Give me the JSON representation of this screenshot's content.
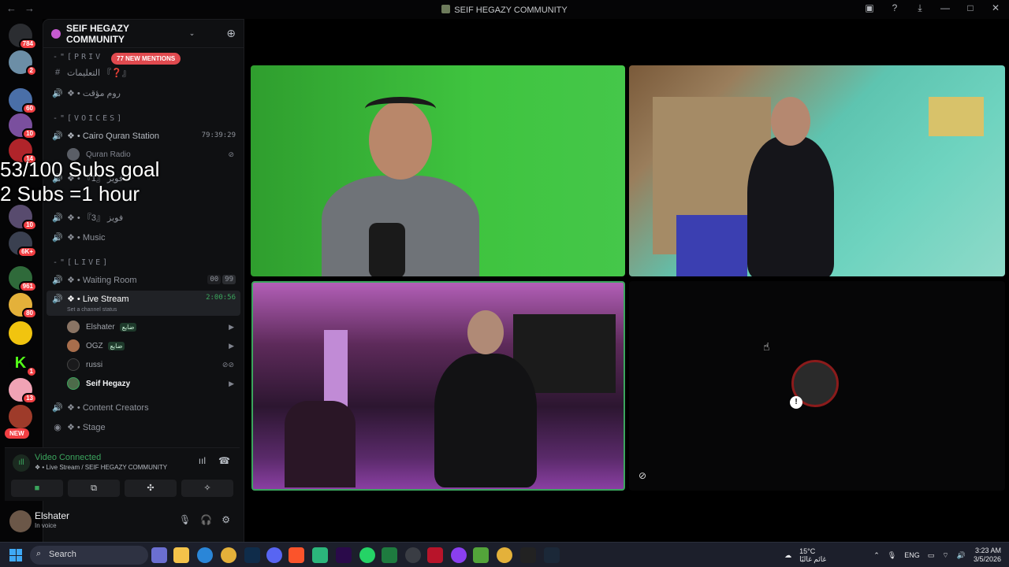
{
  "window": {
    "title": "SEIF HEGAZY COMMUNITY"
  },
  "guilds": {
    "home_badge": "784",
    "badges": [
      "2",
      "60",
      "10",
      "14",
      "10",
      "6K+",
      "961",
      "80",
      "1",
      "13"
    ],
    "new_label": "NEW"
  },
  "server": {
    "name": "SEIF HEGAZY COMMUNITY",
    "mentions": "77 NEW MENTIONS",
    "categories": {
      "private": "-\"[PRIV",
      "voices": "-\"[VOICES]",
      "live": "-\"[LIVE]"
    },
    "channels": {
      "instructions": "التعليمات 『❓』",
      "temp_room": "❖ • روم مؤقت",
      "cairo_quran": "❖ • Cairo Quran Station",
      "cairo_quran_timer": "79:39:29",
      "quran_radio": "Quran Radio",
      "fuyuz1": "❖ • فويز 『1』",
      "fuyuz3": "❖ • فويز 『3』",
      "music": "❖ • Music",
      "waiting_room": "❖ • Waiting Room",
      "waiting_room_count": "00",
      "waiting_room_limit": "99",
      "live_stream": "❖ • Live Stream",
      "live_stream_timer": "2:00:56",
      "live_stream_status": "Set a channel status",
      "content_creators": "❖ • Content Creators",
      "stage": "❖ • Stage"
    },
    "voice_users": [
      {
        "name": "Elshater",
        "tag": "ضايع"
      },
      {
        "name": "OGZ",
        "tag": "ضايع"
      },
      {
        "name": "russi",
        "tag": ""
      },
      {
        "name": "Seif Hegazy",
        "tag": ""
      }
    ]
  },
  "voice_panel": {
    "status": "Video Connected",
    "location": "❖ • Live Stream / SEIF HEGAZY COMMUNITY"
  },
  "user_panel": {
    "name": "Elshater",
    "status": "In voice"
  },
  "overlay": {
    "line1": "53/100 Subs goal",
    "line2": "2 Subs =1 hour"
  },
  "taskbar": {
    "search_label": "Search",
    "weather_temp": "15°C",
    "weather_text": "غائم غالبًا",
    "language": "ENG",
    "time": "3:23 AM",
    "date": "3/5/2026"
  }
}
